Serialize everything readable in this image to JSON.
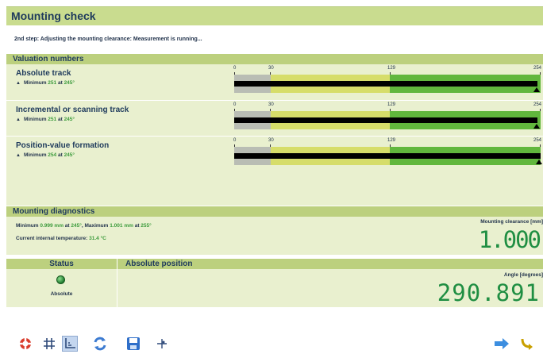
{
  "window": {
    "title": "Mounting check"
  },
  "step": {
    "text": "2nd step: Adjusting the mounting clearance: Measurement is running..."
  },
  "valuation": {
    "heading": "Valuation numbers",
    "scale_labels": [
      "0",
      "30",
      "129",
      "254"
    ],
    "rows": [
      {
        "title": "Absolute track",
        "min_label": "Minimum",
        "min_value": "251",
        "at_label": "at",
        "angle": "245°"
      },
      {
        "title": "Incremental or scanning track",
        "min_label": "Minimum",
        "min_value": "251",
        "at_label": "at",
        "angle": "245°"
      },
      {
        "title": "Position-value formation",
        "min_label": "Minimum",
        "min_value": "254",
        "at_label": "at",
        "angle": "245°"
      }
    ]
  },
  "diagnostics": {
    "heading": "Mounting diagnostics",
    "min_label": "Minimum",
    "min_value": "0.999 mm",
    "min_at": "at",
    "min_angle": "245°",
    "max_label": ", Maximum",
    "max_value": "1.001 mm",
    "max_at": "at",
    "max_angle": "255°",
    "temp_label": "Current internal temperature:",
    "temp_value": "31.4 °C",
    "clearance_label": "Mounting clearance [mm]",
    "clearance_value": "1.000"
  },
  "status": {
    "heading": "Status",
    "led_label": "Absolute",
    "position_heading": "Absolute position",
    "angle_label": "Angle [degrees]",
    "angle_value": "290.891"
  },
  "colors": {
    "header": "#c9dc8f",
    "panel": "#e9f0cf",
    "digits": "#1f8e42",
    "bar_gray": "#b9bdb4",
    "bar_yellow": "#d6dd6a",
    "bar_green": "#61b73d"
  },
  "toolbar": {
    "left_icons": [
      "help-icon",
      "grid-icon",
      "axes-icon",
      "refresh-icon",
      "save-icon",
      "crosshair-icon"
    ],
    "right_icons": [
      "next-arrow-icon",
      "exit-icon"
    ]
  }
}
